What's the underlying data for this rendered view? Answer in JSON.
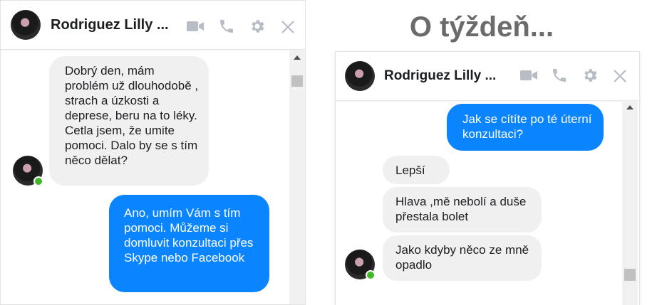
{
  "title": "O týždeň...",
  "colors": {
    "accent_blue": "#0a84ff",
    "incoming_bg": "#f1f0f0",
    "online_green": "#42b72a",
    "icon_gray": "#b7bcc5"
  },
  "chat1": {
    "header": {
      "name": "Rodriguez Lilly ...",
      "icons": [
        "video-camera-icon",
        "phone-icon",
        "gear-icon",
        "close-icon"
      ]
    },
    "messages": [
      {
        "direction": "incoming",
        "text": "Dobrý den, mám problém už dlouhodobě , strach a úzkosti a deprese, beru na to léky. Cetla jsem, že umite pomoci. Dalo by se s tím něco dělat?"
      },
      {
        "direction": "outgoing",
        "text": "Ano, umím Vám s tím pomoci. Můžeme si domluvit konzultaci přes Skype nebo Facebook"
      }
    ]
  },
  "chat2": {
    "header": {
      "name": "Rodriguez Lilly ...",
      "icons": [
        "video-camera-icon",
        "phone-icon",
        "gear-icon",
        "close-icon"
      ]
    },
    "messages": [
      {
        "direction": "outgoing",
        "text": "Jak se cítíte po té úterní konzultaci?"
      },
      {
        "direction": "incoming",
        "text": "Lepší"
      },
      {
        "direction": "incoming",
        "text": "Hlava ,mě nebolí a duše přestala bolet"
      },
      {
        "direction": "incoming",
        "text": "Jako kdyby něco ze mně opadlo"
      }
    ]
  }
}
